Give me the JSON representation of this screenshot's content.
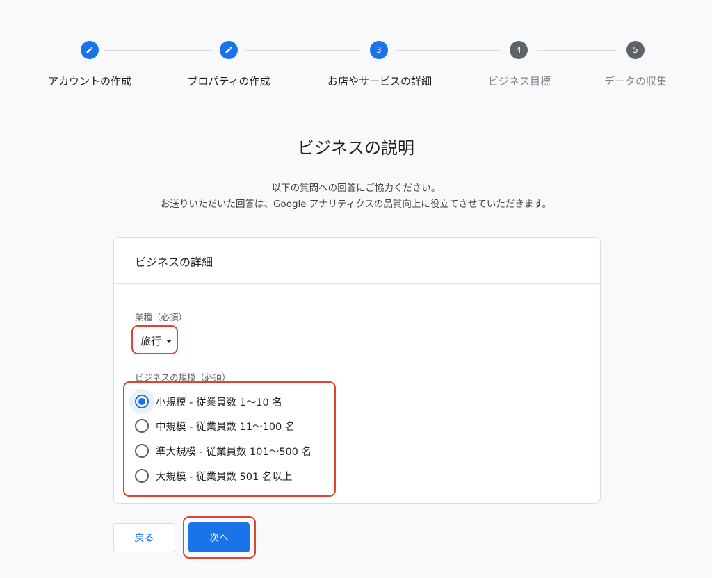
{
  "stepper": {
    "steps": [
      {
        "label": "アカウントの作成",
        "state": "done",
        "number": "1"
      },
      {
        "label": "プロパティの作成",
        "state": "done",
        "number": "2"
      },
      {
        "label": "お店やサービスの詳細",
        "state": "active",
        "number": "3"
      },
      {
        "label": "ビジネス目標",
        "state": "future",
        "number": "4"
      },
      {
        "label": "データの収集",
        "state": "future",
        "number": "5"
      }
    ],
    "done_icon": "pencil-icon"
  },
  "page": {
    "title": "ビジネスの説明",
    "intro_line1": "以下の質問への回答にご協力ください。",
    "intro_line2": "お送りいただいた回答は、Google アナリティクスの品質向上に役立てさせていただきます。"
  },
  "card": {
    "header": "ビジネスの詳細",
    "industry": {
      "label": "業種（必須）",
      "selected": "旅行"
    },
    "size": {
      "label": "ビジネスの規模（必須）",
      "options": [
        {
          "label": "小規模 - 従業員数 1〜10 名",
          "checked": true
        },
        {
          "label": "中規模 - 従業員数 11〜100 名",
          "checked": false
        },
        {
          "label": "準大規模 - 従業員数 101〜500 名",
          "checked": false
        },
        {
          "label": "大規模 - 従業員数 501 名以上",
          "checked": false
        }
      ]
    }
  },
  "buttons": {
    "back": "戻る",
    "next": "次へ"
  },
  "colors": {
    "accent": "#1a73e8",
    "highlight": "#e0432f",
    "future_step": "#5f6368"
  }
}
